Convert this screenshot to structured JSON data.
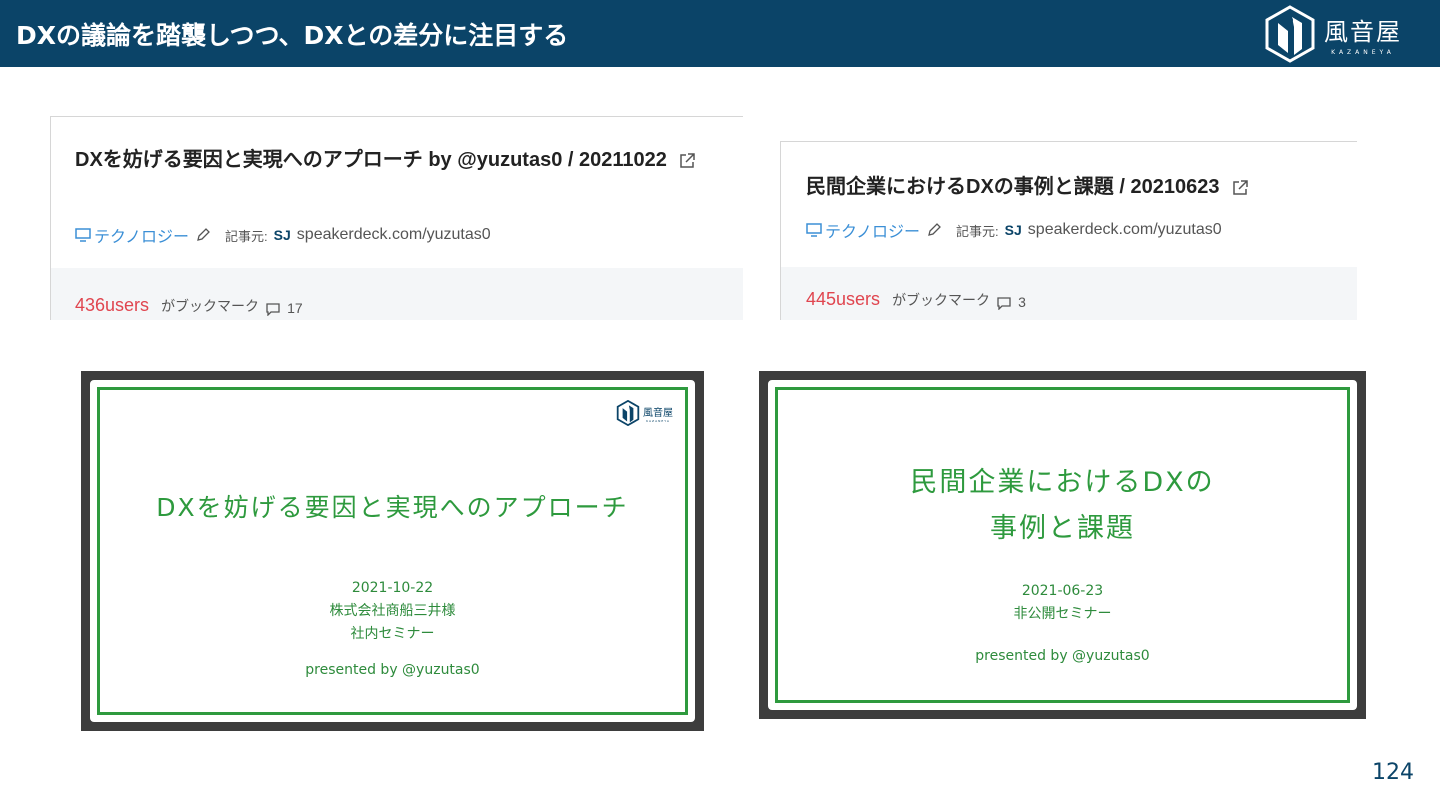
{
  "header": {
    "title": "DXの議論を踏襲しつつ、DXとの差分に注目する",
    "logo_name": "風音屋",
    "logo_sub": "KAZANEYA"
  },
  "cards": [
    {
      "title": "DXを妨げる要因と実現へのアプローチ by @yuzutas0 / 20211022",
      "category": "テクノロジー",
      "source_label": "記事元:",
      "source_logo": "SJ",
      "source": "speakerdeck.com/yuzutas0",
      "users": "436users",
      "bookmark_label": "がブックマーク",
      "comments": "17"
    },
    {
      "title": "民間企業におけるDXの事例と課題 / 20210623",
      "category": "テクノロジー",
      "source_label": "記事元:",
      "source_logo": "SJ",
      "source": "speakerdeck.com/yuzutas0",
      "users": "445users",
      "bookmark_label": "がブックマーク",
      "comments": "3"
    }
  ],
  "slides": [
    {
      "title_line1": "DXを妨げる要因と実現へのアプローチ",
      "info_line1": "2021-10-22",
      "info_line2": "株式会社商船三井様",
      "info_line3": "社内セミナー",
      "presented": "presented by @yuzutas0",
      "logo_name": "風音屋",
      "logo_sub": "KAZANEYA"
    },
    {
      "title_line1": "民間企業におけるDXの",
      "title_line2": "事例と課題",
      "info_line1": "2021-06-23",
      "info_line2": "非公開セミナー",
      "presented": "presented by @yuzutas0"
    }
  ],
  "page_number": "124",
  "colors": {
    "header_bg": "#0b4468",
    "slide_green": "#2e9a3e",
    "users_red": "#e0454f",
    "category_blue": "#3b8fd6"
  },
  "icons": [
    "kazaneya-logo-icon",
    "external-link-icon",
    "monitor-icon",
    "pencil-icon",
    "comment-icon"
  ]
}
